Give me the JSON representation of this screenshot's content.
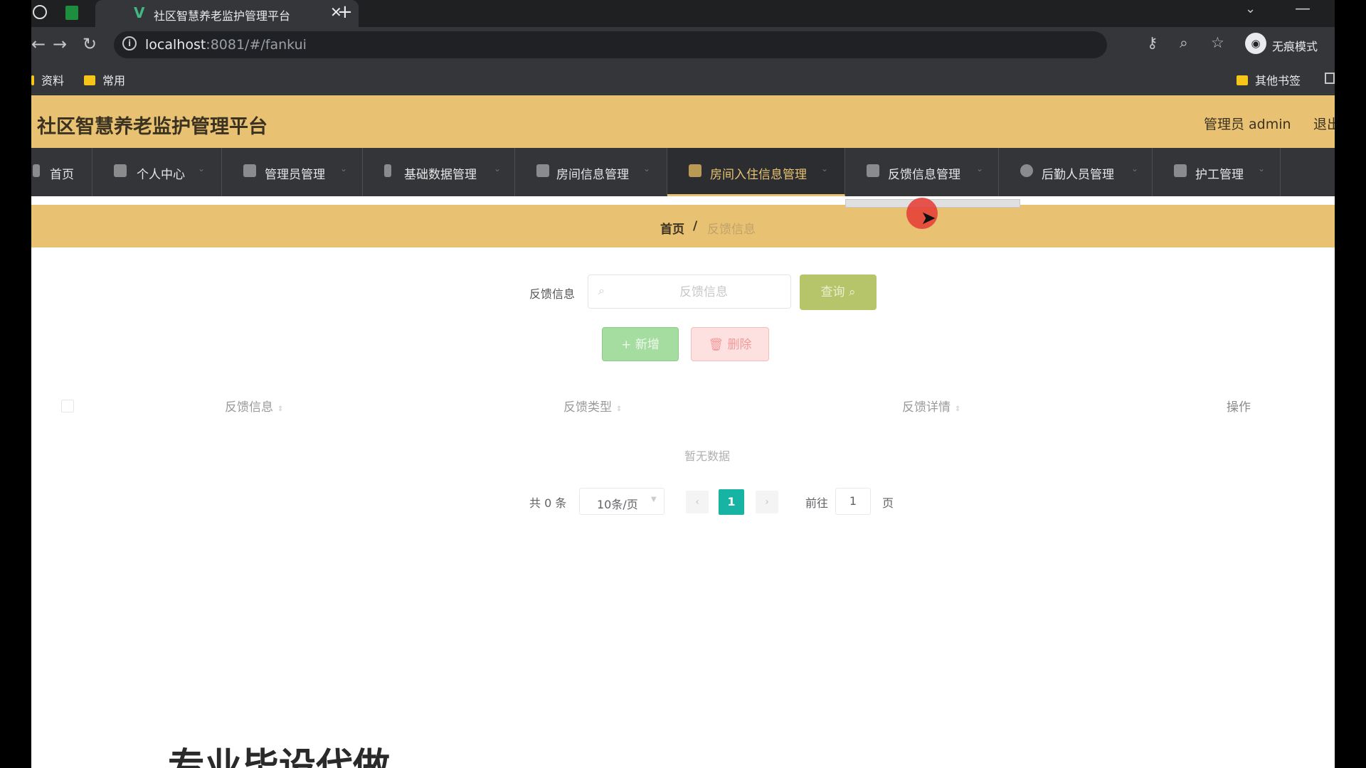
{
  "browser": {
    "tab_title": "社区智慧养老监护管理平台",
    "url_host": "localhost",
    "url_path": ":8081/#/fankui",
    "incognito_label": "无痕模式",
    "bookmarks": [
      "资料",
      "常用"
    ],
    "other_bookmarks": "其他书签"
  },
  "header": {
    "title": "社区智慧养老监护管理平台",
    "user_label": "管理员 admin",
    "logout": "退出"
  },
  "menu": {
    "items": [
      {
        "label": "首页"
      },
      {
        "label": "个人中心"
      },
      {
        "label": "管理员管理"
      },
      {
        "label": "基础数据管理"
      },
      {
        "label": "房间信息管理"
      },
      {
        "label": "房间入住信息管理"
      },
      {
        "label": "反馈信息管理"
      },
      {
        "label": "后勤人员管理"
      },
      {
        "label": "护工管理"
      }
    ],
    "active_index": 5
  },
  "breadcrumb": {
    "home": "首页",
    "separator": "/",
    "current": "反馈信息"
  },
  "search": {
    "label": "反馈信息",
    "placeholder": "反馈信息",
    "query_button": "查询"
  },
  "actions": {
    "add": "+ 新增",
    "delete": "删除"
  },
  "table": {
    "columns": [
      "反馈信息",
      "反馈类型",
      "反馈详情"
    ],
    "operation_column": "操作",
    "empty_text": "暂无数据"
  },
  "pagination": {
    "total": "共 0 条",
    "page_size": "10条/页",
    "current_page": "1",
    "goto_label": "前往",
    "goto_value": "1",
    "page_word": "页"
  },
  "overlay": {
    "watermark": "专业毕设代做"
  },
  "colors": {
    "header_bg": "#e8c272",
    "menu_bg": "#333538",
    "query_btn": "#b6c56a",
    "pager_active": "#17b3a3"
  }
}
